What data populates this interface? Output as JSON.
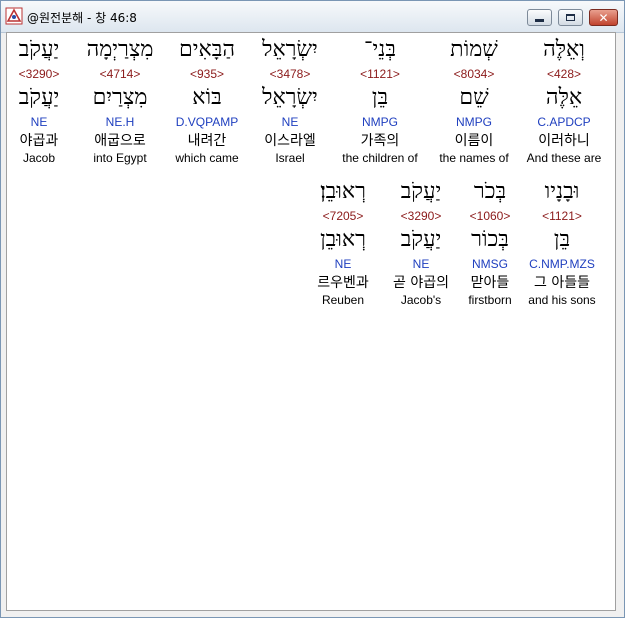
{
  "window": {
    "title": "@원전분해 - 창 46:8"
  },
  "words": [
    {
      "hebrew": "וְאֵלֶּה",
      "strong": "<428>",
      "lemma": "אֵלֶּה",
      "morph": "C.APDCP",
      "korean": "이러하니",
      "english": "And these are"
    },
    {
      "hebrew": "שְׁמוֹת",
      "strong": "<8034>",
      "lemma": "שֵׁם",
      "morph": "NMPG",
      "korean": "이름이",
      "english": "the names of"
    },
    {
      "hebrew": "בְּנֵי־",
      "strong": "<1121>",
      "lemma": "בֵּן",
      "morph": "NMPG",
      "korean": "가족의",
      "english": "the children of"
    },
    {
      "hebrew": "יִשְׂרָאֵל",
      "strong": "<3478>",
      "lemma": "יִשְׂרָאֵל",
      "morph": "NE",
      "korean": "이스라엘",
      "english": "Israel"
    },
    {
      "hebrew": "הַבָּאִים",
      "strong": "<935>",
      "lemma": "בּוֹא",
      "morph": "D.VQPAMP",
      "korean": "내려간",
      "english": "which came"
    },
    {
      "hebrew": "מִצְרַיְמָה",
      "strong": "<4714>",
      "lemma": "מִצְרַיִם",
      "morph": "NE.H",
      "korean": "애굽으로",
      "english": "into Egypt"
    },
    {
      "hebrew": "יַעֲקֹב",
      "strong": "<3290>",
      "lemma": "יַעֲקֹב",
      "morph": "NE",
      "korean": "야곱과",
      "english": "Jacob"
    },
    {
      "hebrew": "וּבָנָיו",
      "strong": "<1121>",
      "lemma": "בֵּן",
      "morph": "C.NMP.MZS",
      "korean": "그 아들들",
      "english": "and his sons"
    },
    {
      "hebrew": "בְּכֹר",
      "strong": "<1060>",
      "lemma": "בְּכוֹר",
      "morph": "NMSG",
      "korean": "맏아들",
      "english": "firstborn"
    },
    {
      "hebrew": "יַעֲקֹב",
      "strong": "<3290>",
      "lemma": "יַעֲקֹב",
      "morph": "NE",
      "korean": "곧 야곱의",
      "english": "Jacob's"
    },
    {
      "hebrew": "רְאוּבֵן׃",
      "strong": "<7205>",
      "lemma": "רְאוּבֵן",
      "morph": "NE",
      "korean": "르우벤과",
      "english": "Reuben"
    }
  ],
  "colors": {
    "strong": "#8b1a1a",
    "morph": "#1f3fbf"
  }
}
